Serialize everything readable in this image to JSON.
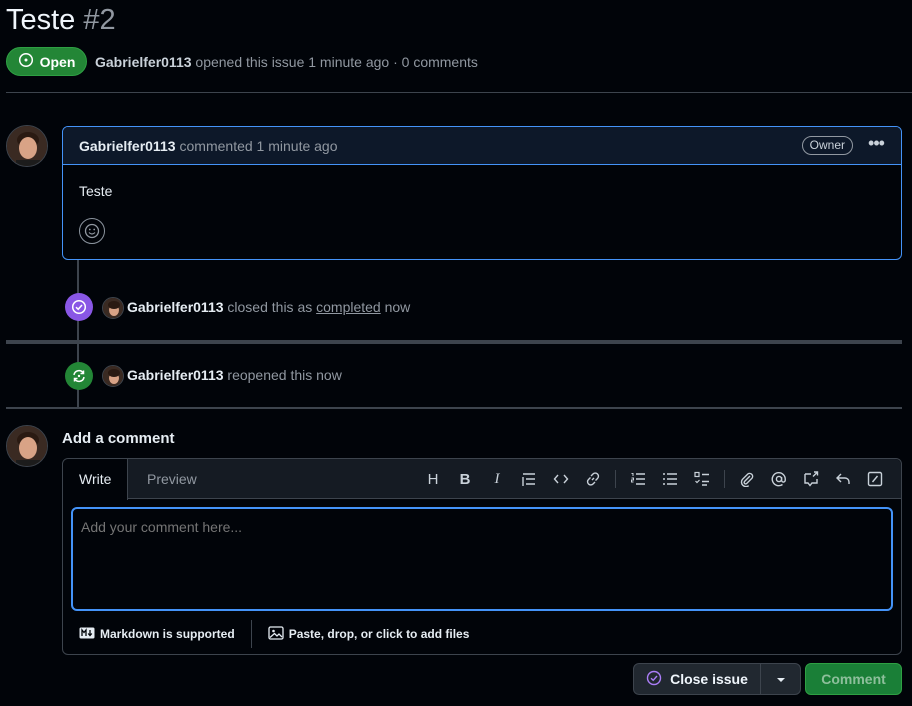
{
  "issue": {
    "title": "Teste",
    "number": "#2",
    "status": "Open",
    "author": "Gabrielfer0113",
    "meta_text": "opened this issue 1 minute ago · 0 comments"
  },
  "comment": {
    "author": "Gabrielfer0113",
    "action": "commented 1 minute ago",
    "badge": "Owner",
    "body": "Teste"
  },
  "events": [
    {
      "author": "Gabrielfer0113",
      "text_before": "closed this as",
      "link": "completed",
      "text_after": "now",
      "icon": "check-circle-icon",
      "color": "#8957e5"
    },
    {
      "author": "Gabrielfer0113",
      "text_before": "reopened this now",
      "link": "",
      "text_after": "",
      "icon": "sync-icon",
      "color": "#238636"
    }
  ],
  "editor": {
    "heading": "Add a comment",
    "tabs": [
      "Write",
      "Preview"
    ],
    "placeholder": "Add your comment here...",
    "markdown_label": "Markdown is supported",
    "files_label": "Paste, drop, or click to add files"
  },
  "actions": {
    "close_label": "Close issue",
    "comment_label": "Comment"
  }
}
